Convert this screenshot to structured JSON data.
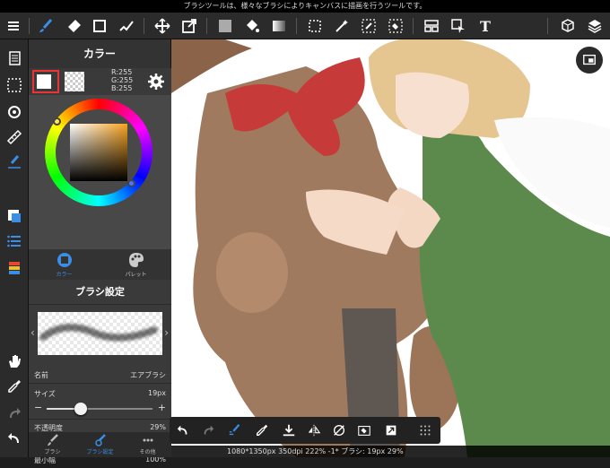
{
  "tooltip": "ブラシツールは、様々なブラシによりキャンバスに描画を行うツールです。",
  "toolbar": {
    "text_tool_glyph": "T"
  },
  "color_panel": {
    "title": "カラー",
    "rgb": {
      "r": "R:255",
      "g": "G:255",
      "b": "B:255"
    },
    "tab_color": "カラー",
    "tab_palette": "パレット",
    "current_color": "#ffffff"
  },
  "brush_panel": {
    "title": "ブラシ設定",
    "name_label": "名前",
    "name_value": "エアブラシ",
    "size_label": "サイズ",
    "size_value": "19px",
    "size_fraction": 0.32,
    "opacity_label": "不透明度",
    "opacity_value": "29%",
    "opacity_fraction": 0.29,
    "min_width_label": "最小幅",
    "min_width_value": "100%"
  },
  "bottom_tabs": [
    {
      "label": "ブラシ"
    },
    {
      "label": "ブラシ設定"
    },
    {
      "label": "その他"
    }
  ],
  "status": "1080*1350px 350dpi 222% -1* ブラシ: 19px 29%",
  "accent": "#3a8ee6"
}
